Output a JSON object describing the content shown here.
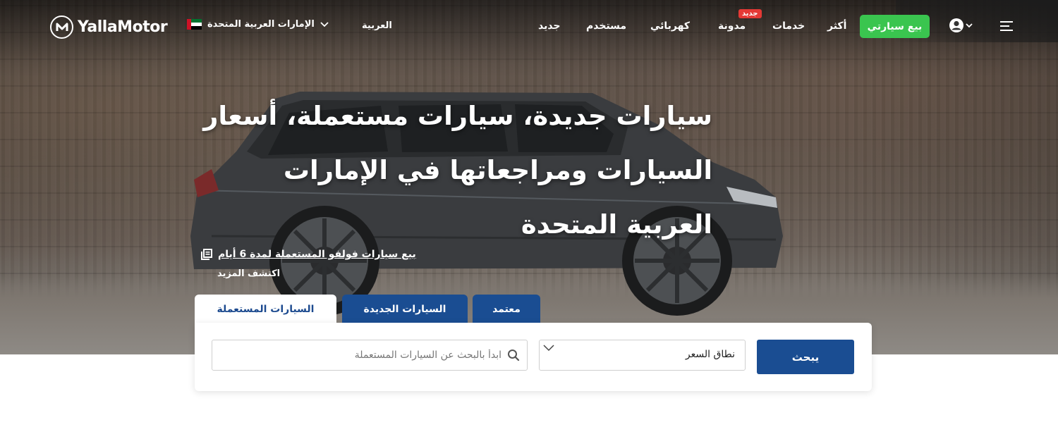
{
  "brand": {
    "name": "YallaMotor"
  },
  "header": {
    "country_label": "الإمارات العربية المتحدة",
    "language_label": "العربية",
    "nav": [
      {
        "label": "جديد"
      },
      {
        "label": "مستخدم"
      },
      {
        "label": "كهربائي"
      },
      {
        "label": "مدونة",
        "badge": "جديد"
      },
      {
        "label": "خدمات"
      },
      {
        "label": "أكثر"
      }
    ],
    "sell_button": "بيع سيارتي"
  },
  "hero": {
    "headline": "سيارات جديدة، سيارات مستعملة، أسعار السيارات ومراجعاتها في الإمارات العربية المتحدة",
    "promo_text": "بيع سيارات فولفو المستعملة لمدة 6 أيام",
    "promo_more": "اكتشف المزيد"
  },
  "tabs": [
    {
      "label": "السيارات المستعملة",
      "active": true
    },
    {
      "label": "السيارات الجديدة",
      "active": false
    },
    {
      "label": "معتمد",
      "active": false
    }
  ],
  "search": {
    "placeholder": "ابدأ بالبحث عن السيارات المستعملة",
    "price_label": "نطاق السعر",
    "button": "يبحث"
  },
  "colors": {
    "accent_green": "#3ac54f",
    "primary_blue": "#1a4d92",
    "badge_red": "#e53935"
  },
  "icons": [
    "logo-mark-icon",
    "uae-flag-icon",
    "chevron-down-icon",
    "user-icon",
    "hamburger-menu-icon",
    "document-icon",
    "search-icon"
  ]
}
